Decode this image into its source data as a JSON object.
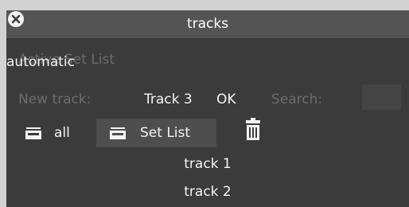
{
  "window": {
    "title": "tracks"
  },
  "setlist": {
    "label": "Active Set List",
    "mode": "automatic"
  },
  "new_track": {
    "label": "New track:",
    "value": "Track 3",
    "ok_label": "OK"
  },
  "search": {
    "label": "Search:",
    "value": ""
  },
  "filters": {
    "all_label": "all",
    "setlist_label": "Set List"
  },
  "tracks": [
    "track 1",
    "track 2"
  ],
  "icons": {
    "close": "close-icon",
    "list": "list-icon",
    "trash": "trash-icon"
  },
  "colors": {
    "background": "#3b3b3b",
    "titlebar": "#545454",
    "selected": "#4e4e4e",
    "dim_text": "#6c6c6c"
  }
}
